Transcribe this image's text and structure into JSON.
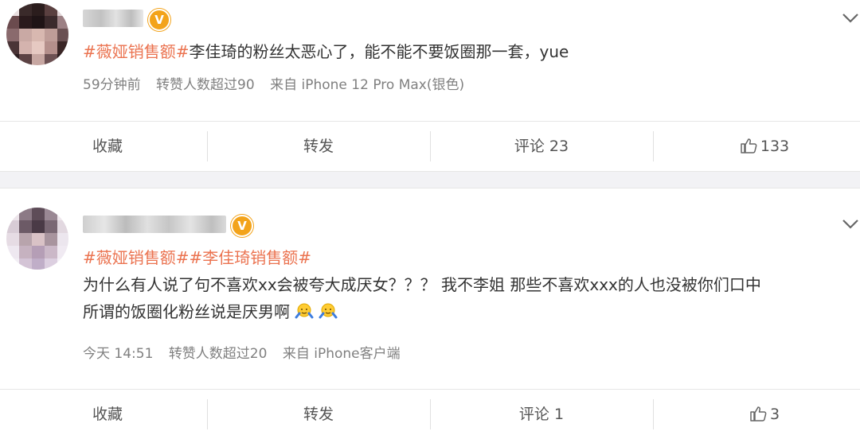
{
  "posts": [
    {
      "topics": [
        "#薇娅销售额#"
      ],
      "text": "李佳琦的粉丝太恶心了，能不能不要饭圈那一套，yue",
      "meta": {
        "time": "59分钟前",
        "reposts_info": "转赞人数超过90",
        "source": "来自 iPhone 12 Pro Max(银色)"
      },
      "actions": {
        "favorite": "收藏",
        "repost": "转发",
        "comment": "评论 23",
        "like_count": "133"
      }
    },
    {
      "topics": [
        "#薇娅销售额#",
        "#李佳琦销售额#"
      ],
      "text_line1": "为什么有人说了句不喜欢xx会被夸大成厌女？？？ 我不李姐 那些不喜欢xxx的人也没被你们口中",
      "text_line2": "所谓的饭圈化粉丝说是厌男啊",
      "meta": {
        "time": "今天 14:51",
        "reposts_info": "转赞人数超过20",
        "source": "来自 iPhone客户端"
      },
      "actions": {
        "favorite": "收藏",
        "repost": "转发",
        "comment": "评论 1",
        "like_count": "3"
      }
    }
  ],
  "colors": {
    "topic": "#eb7350",
    "verified_badge": "#f3a31a",
    "meta_text": "#808080"
  },
  "icons": [
    "chevron-down-icon",
    "verified-badge-icon",
    "thumbs-up-icon",
    "shrug-emoji-icon"
  ]
}
